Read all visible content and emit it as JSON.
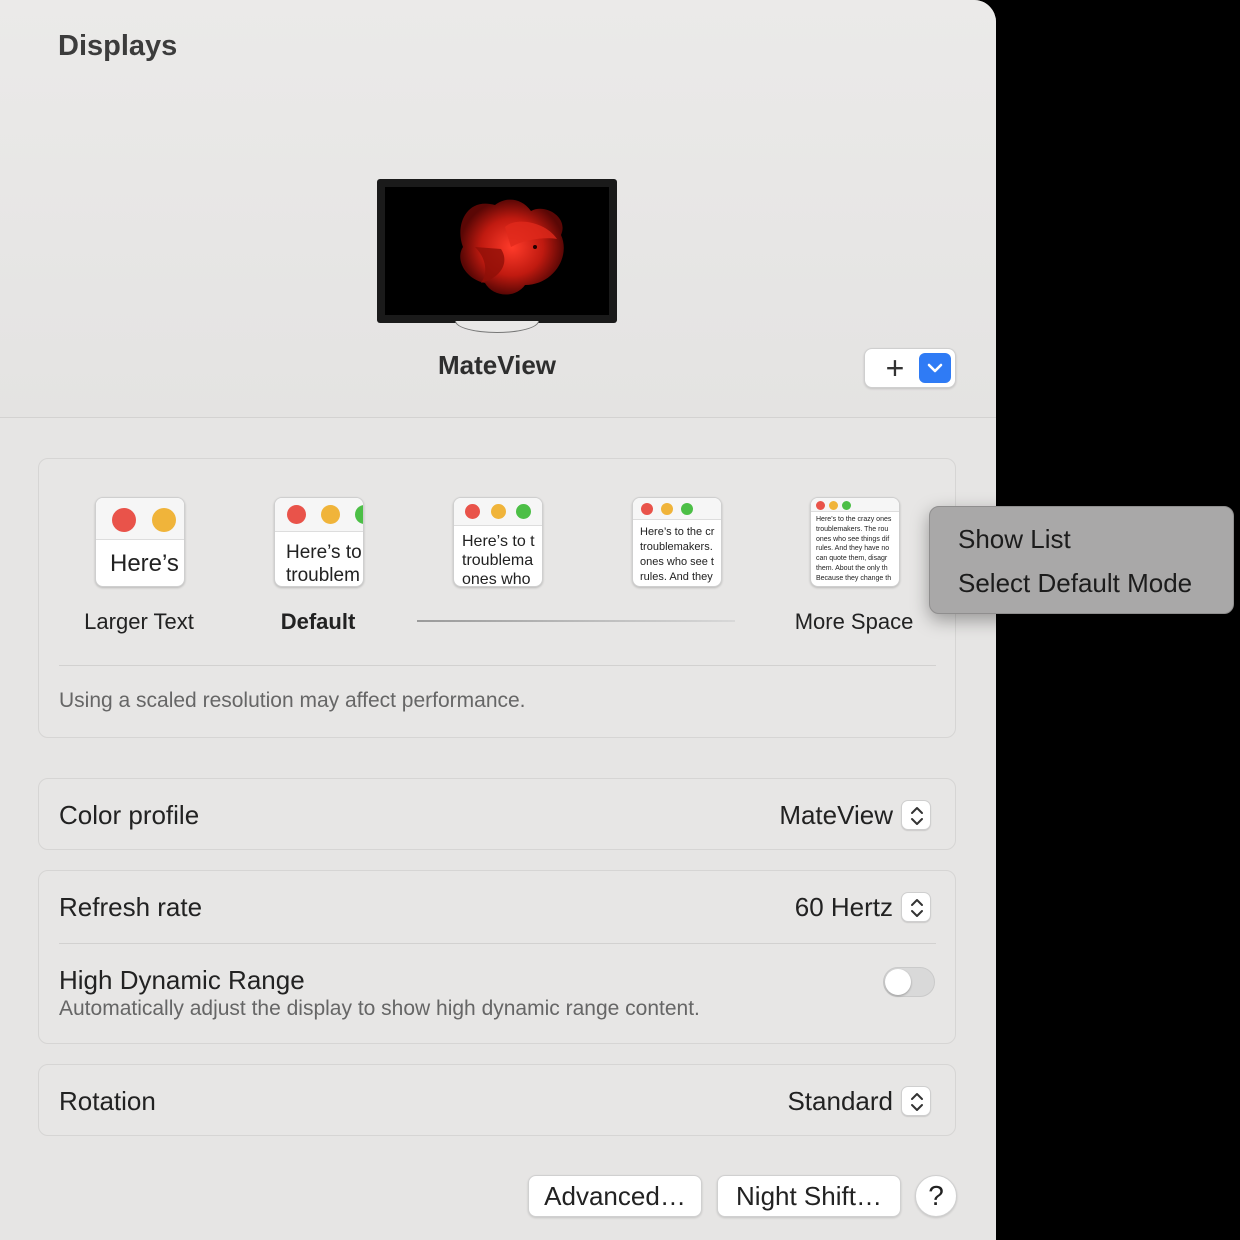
{
  "window": {
    "title": "Displays"
  },
  "display": {
    "name": "MateView",
    "add_label": "+",
    "wallpaper": "red-betta-fish"
  },
  "resolution": {
    "options": [
      {
        "label": "Larger Text",
        "sample_text": "Here’s"
      },
      {
        "label": "Default",
        "sample_text": "Here’s to\ntroublem"
      },
      {
        "label": "",
        "sample_text": "Here’s to t\ntroublema\nones who"
      },
      {
        "label": "",
        "sample_text": "Here’s to the cr\ntroublemakers.\nones who see t\nrules. And they"
      },
      {
        "label": "More Space",
        "sample_text": "Here’s to the crazy ones\ntroublemakers. The rou\nones who see things dif\nrules. And they have no\ncan quote them, disagr\nthem. About the only th\nBecause they change th"
      }
    ],
    "selected": "Default",
    "note": "Using a scaled resolution may affect performance."
  },
  "color_profile": {
    "label": "Color profile",
    "value": "MateView"
  },
  "refresh_rate": {
    "label": "Refresh rate",
    "value": "60 Hertz"
  },
  "hdr": {
    "label": "High Dynamic Range",
    "description": "Automatically adjust the display to show high dynamic range content.",
    "enabled": false
  },
  "rotation": {
    "label": "Rotation",
    "value": "Standard"
  },
  "buttons": {
    "advanced": "Advanced…",
    "night_shift": "Night Shift…",
    "help": "?"
  },
  "context_menu": {
    "items": [
      "Show List",
      "Select Default Mode"
    ]
  },
  "colors": {
    "accent": "#2f7bf5",
    "traffic_red": "#e9534a",
    "traffic_yellow": "#f0b43a",
    "traffic_green": "#4cbf46"
  }
}
